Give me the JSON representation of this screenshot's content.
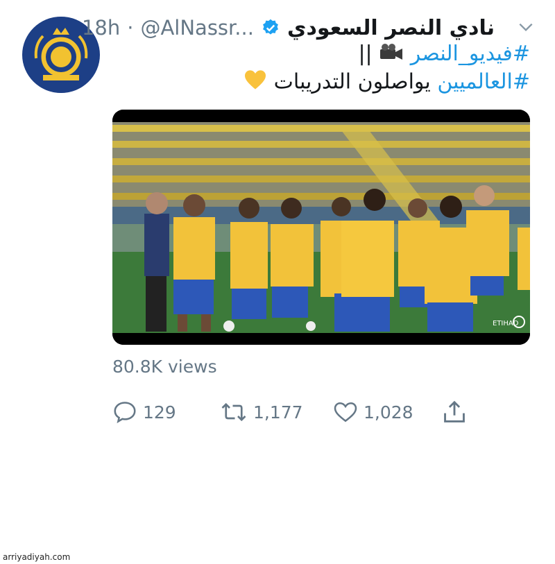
{
  "tweet": {
    "display_name": "نادي النصر السعودي",
    "handle": "@AlNassr...",
    "separator": "·",
    "time": "18h",
    "hashtag1": "#فيديو_النصر",
    "line1_suffix": "||",
    "hashtag2": "#العالميين",
    "line2_text": " يواصلون التدريبات ",
    "avatar_text": "AL NASSR",
    "views": "80.8K views",
    "media_overlay_text": "ETIHAD"
  },
  "actions": {
    "reply_count": "129",
    "retweet_count": "1,177",
    "like_count": "1,028"
  },
  "icons": {
    "verified": "verified-icon",
    "chevron": "chevron-down-icon",
    "reply": "reply-icon",
    "retweet": "retweet-icon",
    "like": "heart-icon",
    "share": "share-icon",
    "camera": "movie-camera-icon",
    "heart_emoji": "yellow-heart-icon"
  },
  "colors": {
    "link": "#1b95e0",
    "secondary": "#657786",
    "verified": "#1da1f2"
  },
  "watermark": "arriyadiyah.com"
}
